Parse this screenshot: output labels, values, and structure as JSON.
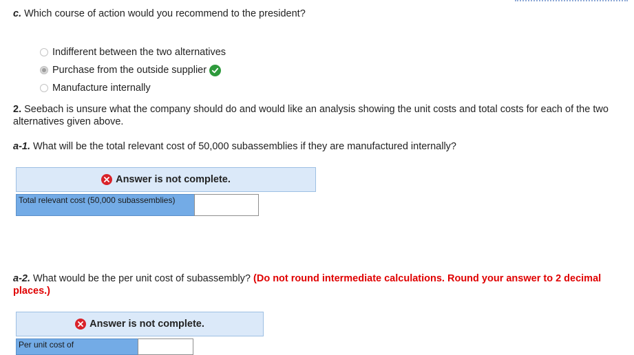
{
  "question_c": {
    "prefix": "c.",
    "text": "Which course of action would you recommend to the president?"
  },
  "options": [
    {
      "label": "Indifferent between the two alternatives",
      "selected": false,
      "correct": false
    },
    {
      "label": "Purchase from the outside supplier",
      "selected": true,
      "correct": true
    },
    {
      "label": "Manufacture internally",
      "selected": false,
      "correct": false
    }
  ],
  "question_2": {
    "prefix": "2.",
    "text": "Seebach is unsure what the company should do and would like an analysis showing the unit costs and total costs for each of the two alternatives given above."
  },
  "question_a1": {
    "prefix": "a-1.",
    "text": "What will be the total relevant cost of 50,000 subassemblies if they are manufactured internally?"
  },
  "feedback_a1": {
    "text": "Answer is not complete."
  },
  "answer_a1": {
    "label": "Total relevant cost (50,000 subassemblies)",
    "value": ""
  },
  "question_a2": {
    "prefix": "a-2.",
    "text": "What would be the per unit cost of subassembly?",
    "instruction": "(Do not round intermediate calculations. Round your answer to 2 decimal places.)"
  },
  "feedback_a2": {
    "text": "Answer is not complete."
  },
  "answer_a2": {
    "label": "Per unit cost of",
    "value": ""
  },
  "colors": {
    "banner_bg": "#dbe9f9",
    "label_bg": "#73abe6",
    "error_red": "#d9232a",
    "correct_green": "#2e9a3c",
    "instruction_red": "#e00000"
  }
}
